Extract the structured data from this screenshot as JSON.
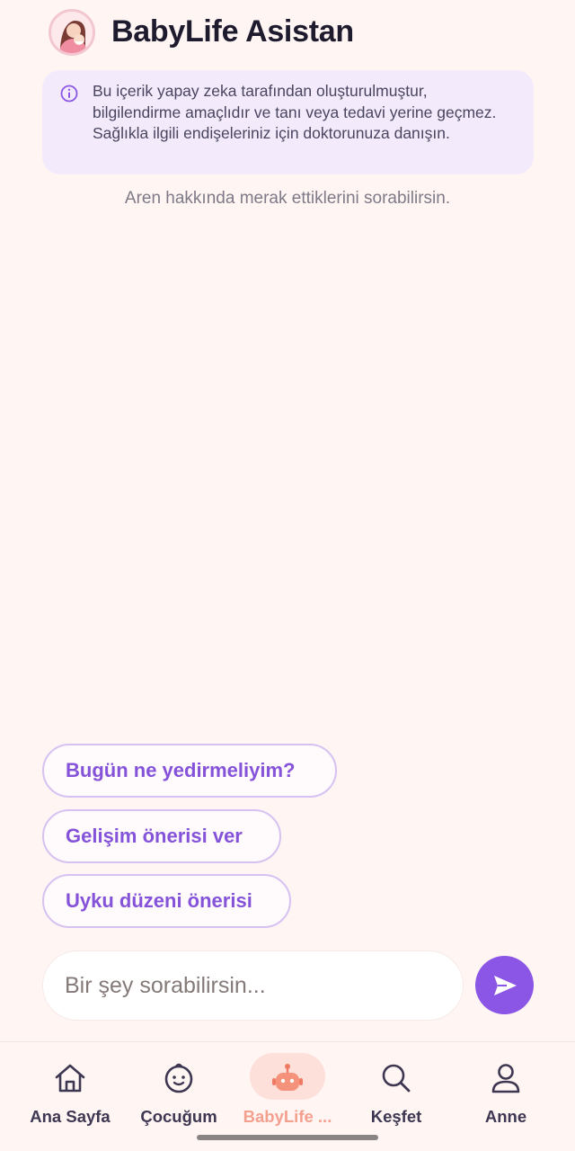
{
  "header": {
    "title": "BabyLife Asistan",
    "avatar_icon": "mother-baby-avatar"
  },
  "disclaimer": {
    "icon": "info-icon",
    "text": "Bu içerik yapay zeka tarafından oluşturulmuştur, bilgilendirme amaçlıdır ve tanı veya tedavi yerine geçmez. Sağlıkla ilgili endişeleriniz için doktorunuza danışın."
  },
  "hint": "Aren hakkında merak ettiklerini sorabilirsin.",
  "suggestions": [
    {
      "label": "Bugün ne yedirmeliyim?"
    },
    {
      "label": "Gelişim önerisi ver"
    },
    {
      "label": "Uyku düzeni önerisi"
    }
  ],
  "input": {
    "placeholder": "Bir şey sorabilirsin...",
    "value": ""
  },
  "send": {
    "icon": "send-icon"
  },
  "nav": {
    "items": [
      {
        "label": "Ana Sayfa",
        "icon": "home-icon"
      },
      {
        "label": "Çocuğum",
        "icon": "baby-face-icon"
      },
      {
        "label": "BabyLife ...",
        "icon": "robot-icon",
        "active": true
      },
      {
        "label": "Keşfet",
        "icon": "search-icon"
      },
      {
        "label": "Anne",
        "icon": "person-icon"
      }
    ]
  },
  "colors": {
    "background": "#fff5f3",
    "accent": "#8b55e6",
    "active_tab": "#f4a08e",
    "disclaimer_bg": "#f3ebfb"
  }
}
